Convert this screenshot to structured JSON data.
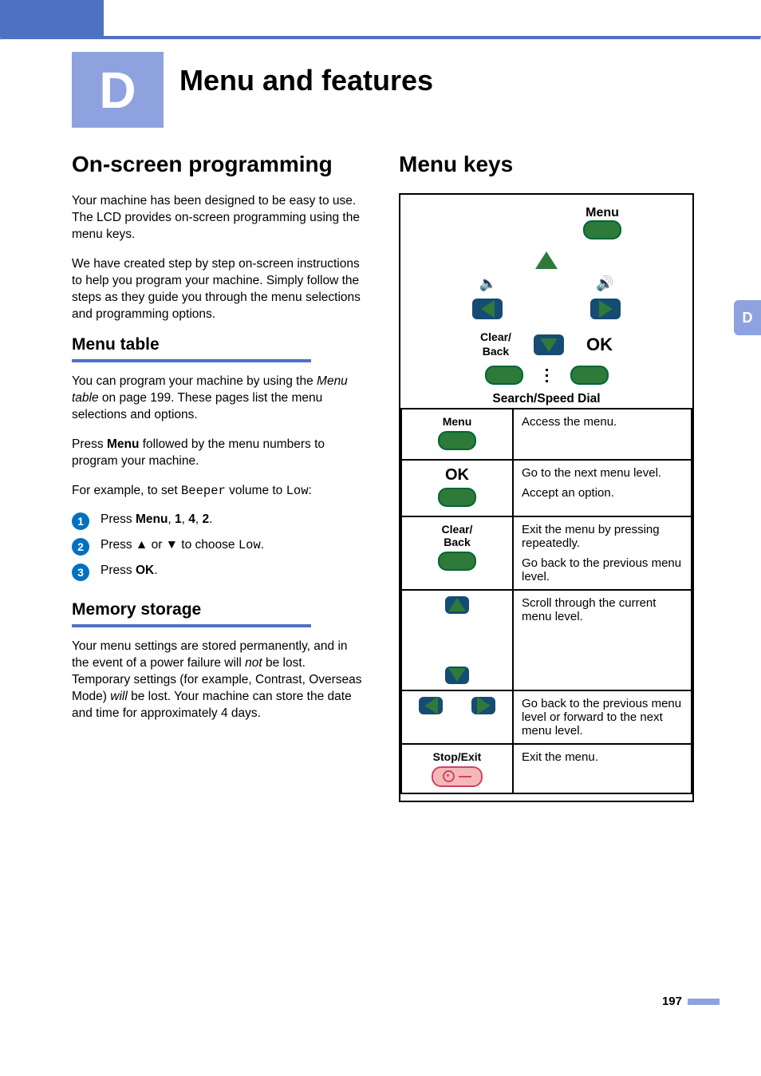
{
  "section_letter": "D",
  "page_title": "Menu and features",
  "side_tab": "D",
  "left": {
    "h2": "On-screen programming",
    "p1": "Your machine has been designed to be easy to use. The LCD provides on-screen programming using the menu keys.",
    "p2": "We have created step by step on-screen instructions to help you program your machine. Simply follow the steps as they guide you through the menu selections and programming options.",
    "h3a": "Menu table",
    "p3a": "You can program your machine by using the ",
    "p3b": "Menu table",
    "p3c": " on page 199. These pages list the menu selections and options.",
    "p4a": "Press ",
    "p4b": "Menu",
    "p4c": " followed by the menu numbers to program your machine.",
    "p5a": "For example, to set ",
    "p5b": "Beeper",
    "p5c": " volume to ",
    "p5d": "Low",
    "p5e": ":",
    "step1a": "Press ",
    "step1b": "Menu",
    "step1c": ", ",
    "step1d": "1",
    "step1e": ", ",
    "step1f": "4",
    "step1g": ", ",
    "step1h": "2",
    "step1i": ".",
    "step2a": "Press ▲ or ▼ to choose ",
    "step2b": "Low",
    "step2c": ".",
    "step3a": "Press ",
    "step3b": "OK",
    "step3c": ".",
    "h3b": "Memory storage",
    "p6a": "Your menu settings are stored permanently, and in the event of a power failure will ",
    "p6b": "not",
    "p6c": " be lost. Temporary settings (for example, Contrast, Overseas Mode) ",
    "p6d": "will",
    "p6e": " be lost. Your machine can store the date and time for approximately 4 days."
  },
  "right": {
    "h2": "Menu keys",
    "diagram": {
      "menu_label": "Menu",
      "clear_back_label": "Clear/\nBack",
      "ok_label": "OK",
      "search_label": "Search/Speed Dial"
    },
    "table_rows": [
      {
        "key": "Menu",
        "desc": "Access the menu."
      },
      {
        "key": "OK",
        "desc1": "Go to the next menu level.",
        "desc2": "Accept an option."
      },
      {
        "key": "Clear/\nBack",
        "desc1": "Exit the menu by pressing repeatedly.",
        "desc2": "Go back to the previous menu level."
      },
      {
        "key": "updown",
        "desc": "Scroll through the current menu level."
      },
      {
        "key": "leftright",
        "desc": "Go back to the previous menu level or forward to the next menu level."
      },
      {
        "key": "Stop/Exit",
        "desc": "Exit the menu."
      }
    ]
  },
  "page_number": "197"
}
